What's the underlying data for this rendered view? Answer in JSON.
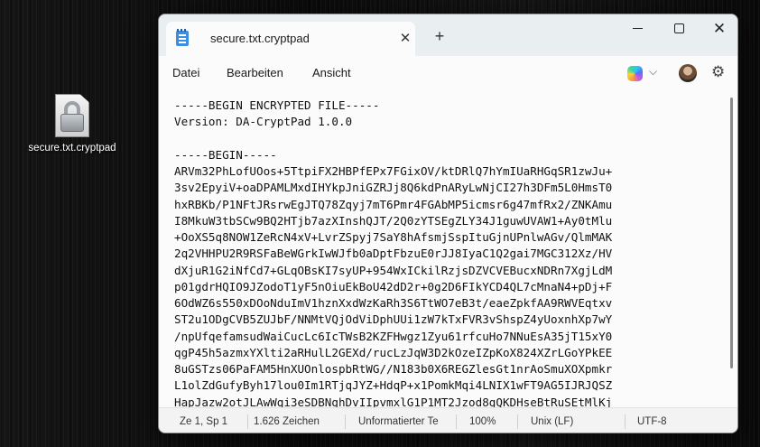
{
  "desktop": {
    "icon_label": "secure.txt.cryptpad",
    "icon_name": "locked-file-icon"
  },
  "window": {
    "tab_title": "secure.txt.cryptpad",
    "tab_close": "✕",
    "new_tab": "+",
    "minimize_icon": "minimize-icon",
    "maximize_icon": "maximize-icon",
    "close_glyph": "✕"
  },
  "menu": {
    "datei": "Datei",
    "bearbeiten": "Bearbeiten",
    "ansicht": "Ansicht",
    "copilot_caret": "⌵",
    "settings_glyph": "⚙"
  },
  "editor": {
    "content": "-----BEGIN ENCRYPTED FILE-----\nVersion: DA-CryptPad 1.0.0\n\n-----BEGIN-----\nARVm32PhLofUOos+5TtpiFX2HBPfEPx7FGixOV/ktDRlQ7hYmIUaRHGqSR1zwJu+\n3sv2EpyiV+oaDPAMLMxdIHYkpJniGZRJj8Q6kdPnARyLwNjCI27h3DFm5L0HmsT0\nhxRBKb/P1NFtJRsrwEgJTQ78Zqyj7mT6Pmr4FGAbMP5icmsr6g47mfRx2/ZNKAmu\nI8MkuW3tbSCw9BQ2HTjb7azXInshQJT/2Q0zYTSEgZLY34J1guwUVAW1+Ay0tMlu\n+OoXS5q8NOW1ZeRcN4xV+LvrZSpyj7SaY8hAfsmjSspItuGjnUPnlwAGv/QlmMAK\n2q2VHHPU2R9RSFaBeWGrkIwWJfb0aDptFbzuE0rJJ8IyaC1Q2gai7MGC312Xz/HV\ndXjuR1G2iNfCd7+GLqOBsKI7syUP+954WxICkilRzjsDZVCVEBucxNDRn7XgjLdM\np01gdrHQIO9JZodoT1yF5nOiuEkBoU42dD2r+0g2D6FIkYCD4QL7cMnaN4+pDj+F\n6OdWZ6s550xDOoNduImV1hznXxdWzKaRh3S6TtWO7eB3t/eaeZpkfAA9RWVEqtxv\nST2u1ODgCVB5ZUJbF/NNMtVQjOdViDphUUi1zW7kTxFVR3vShspZ4yUoxnhXp7wY\n/npUfqefamsudWaiCucLc6IcTWsB2KZFHwgz1Zyu61rfcuHo7NNuEsA35jT15xY0\nqgP45h5azmxYXlti2aRHulL2GEXd/rucLzJqW3D2kOzeIZpKoX824XZrLGoYPkEE\n8uGSTzs06PaFAM5HnXUOnlospbRtWG//N183b0X6REGZlesGt1nrAoSmuXOXpmkr\nL1olZdGufyByh17lou0Im1RTjqJYZ+HdqP+x1PomkMqi4LNIX1wFT9AG5IJRJQSZ\nHapJazw2otJLAwWqi3eSDBNghDvIIpvmxlG1P1MT2Jzod8gQKDHseBtRuSEtMlKj"
  },
  "status": {
    "position": "Ze 1, Sp 1",
    "chars": "1.626 Zeichen",
    "format": "Unformatierter Te",
    "zoom": "100%",
    "line_ending": "Unix (LF)",
    "encoding": "UTF-8"
  }
}
